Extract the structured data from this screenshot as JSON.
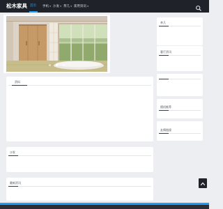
{
  "site": {
    "title": "松木家具"
  },
  "nav": {
    "items": [
      {
        "label": "首页",
        "active": true,
        "has_dropdown": false
      },
      {
        "label": "手机",
        "active": false,
        "has_dropdown": true
      },
      {
        "label": "沙发",
        "active": false,
        "has_dropdown": true
      },
      {
        "label": "茶几",
        "active": false,
        "has_dropdown": true
      },
      {
        "label": "家用资讯",
        "active": false,
        "has_dropdown": true
      }
    ]
  },
  "main": {
    "hero": {
      "slides": 3,
      "active_slide": 1
    },
    "cards": [
      {
        "title": "资料"
      },
      {
        "title": "沙发"
      },
      {
        "title": "最新资讯"
      }
    ]
  },
  "sidebar": {
    "cards": [
      {
        "title": "茶几"
      },
      {
        "title": "客厅资讯"
      },
      {
        "title": ""
      },
      {
        "title": "随机推荐"
      },
      {
        "title": "友情链接"
      }
    ]
  },
  "colors": {
    "accent": "#1e9fff",
    "topbar": "#1f2329",
    "page_background": "#eceef1"
  },
  "icons": {
    "search": "search-icon",
    "back_to_top": "arrow-up-icon",
    "dropdown": "chevron-down-icon"
  }
}
